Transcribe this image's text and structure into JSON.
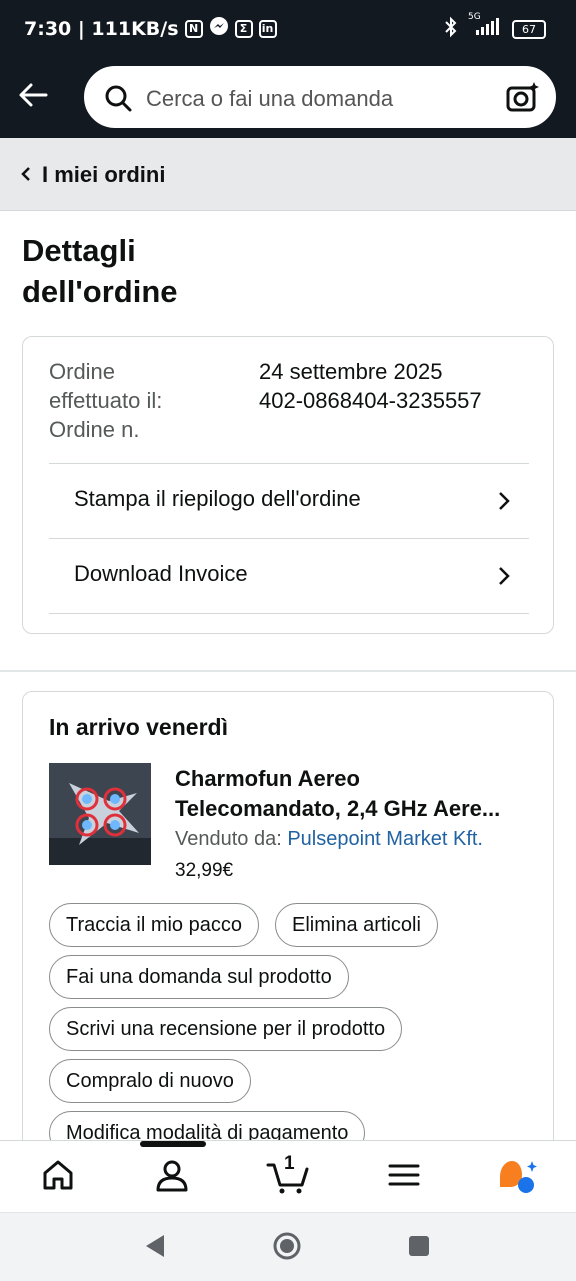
{
  "status_bar": {
    "time_speed": "7:30 | 111KB/s",
    "network": "5G",
    "battery": "67"
  },
  "header": {
    "search_placeholder": "Cerca o fai una domanda"
  },
  "breadcrumb": {
    "label": "I miei ordini"
  },
  "page": {
    "title_line1": "Dettagli",
    "title_line2": "dell'ordine"
  },
  "order_summary": {
    "date_label_line1": "Ordine",
    "date_label_line2": "effettuato il:",
    "number_label": "Ordine n.",
    "date_value": "24 settembre 2025",
    "number_value": "402-0868404-3235557",
    "print_label": "Stampa il riepilogo dell'ordine",
    "invoice_label": "Download Invoice"
  },
  "shipment": {
    "title": "In arrivo venerdì",
    "product_name_line1": "Charmofun Aereo",
    "product_name_line2": "Telecomandato, 2,4 GHz Aere...",
    "seller_prefix": "Venduto da:",
    "seller_name": "Pulsepoint Market Kft.",
    "price": "32,99€",
    "actions": {
      "track": "Traccia il mio pacco",
      "delete": "Elimina articoli",
      "ask": "Fai una domanda sul prodotto",
      "review": "Scrivi una recensione per il prodotto",
      "buy_again": "Compralo di nuovo",
      "payment": "Modifica modalità di pagamento"
    }
  },
  "bottom_nav": {
    "cart_count": "1"
  },
  "colors": {
    "header_bg": "#131921",
    "link": "#2162a1",
    "breadcrumb_bg": "#e7e9ea",
    "rufus_orange": "#f77f1f",
    "rufus_blue": "#1a73e8"
  }
}
